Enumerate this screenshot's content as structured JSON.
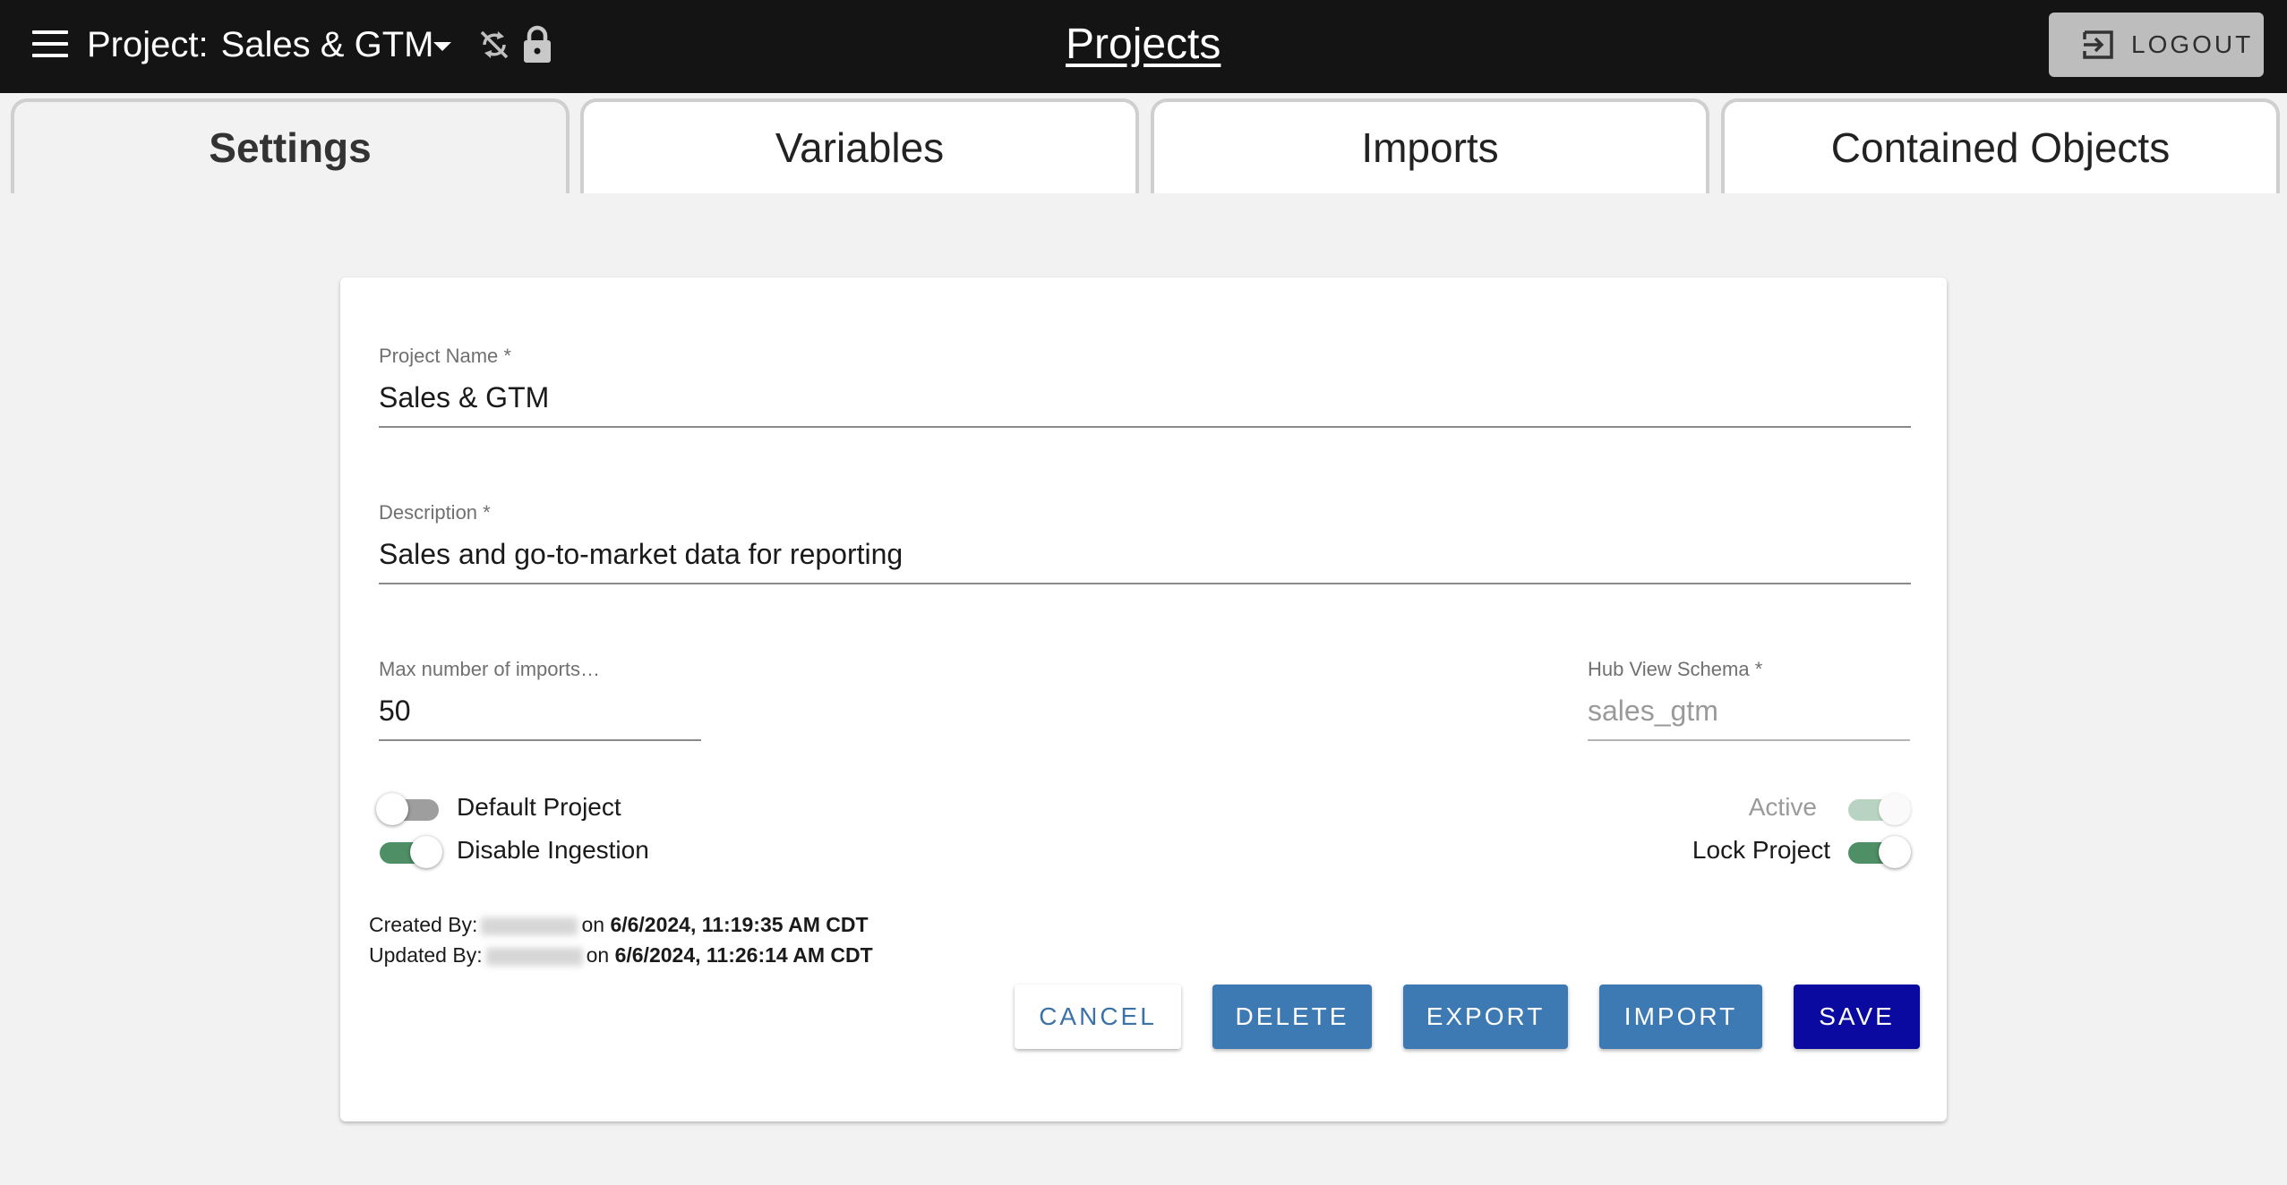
{
  "header": {
    "project_prefix": "Project:",
    "project_name": "Sales & GTM",
    "title": "Projects",
    "logout_label": "LOGOUT"
  },
  "tabs": [
    {
      "label": "Settings",
      "active": true
    },
    {
      "label": "Variables",
      "active": false
    },
    {
      "label": "Imports",
      "active": false
    },
    {
      "label": "Contained Objects",
      "active": false
    }
  ],
  "form": {
    "project_name": {
      "label": "Project Name *",
      "value": "Sales & GTM"
    },
    "description": {
      "label": "Description *",
      "value": "Sales and go-to-market data for reporting"
    },
    "max_imports": {
      "label": "Max number of imports…",
      "value": "50"
    },
    "hub_view_schema": {
      "label": "Hub View Schema *",
      "value": "sales_gtm"
    },
    "toggles": {
      "default_project": {
        "label": "Default Project",
        "state": "off"
      },
      "disable_ingestion": {
        "label": "Disable Ingestion",
        "state": "on"
      },
      "active": {
        "label": "Active",
        "state": "on-disabled"
      },
      "lock_project": {
        "label": "Lock Project",
        "state": "on"
      }
    },
    "created": {
      "prefix": "Created By:",
      "on": "on",
      "date": "6/6/2024, 11:19:35 AM CDT"
    },
    "updated": {
      "prefix": "Updated By:",
      "on": "on",
      "date": "6/6/2024, 11:26:14 AM CDT"
    }
  },
  "buttons": {
    "cancel": "CANCEL",
    "delete": "DELETE",
    "export": "EXPORT",
    "import": "IMPORT",
    "save": "SAVE"
  },
  "colors": {
    "topbar": "#141414",
    "toggle_on": "#4f8f66",
    "button_primary": "#3d79b3",
    "button_save": "#0a0aa0"
  }
}
